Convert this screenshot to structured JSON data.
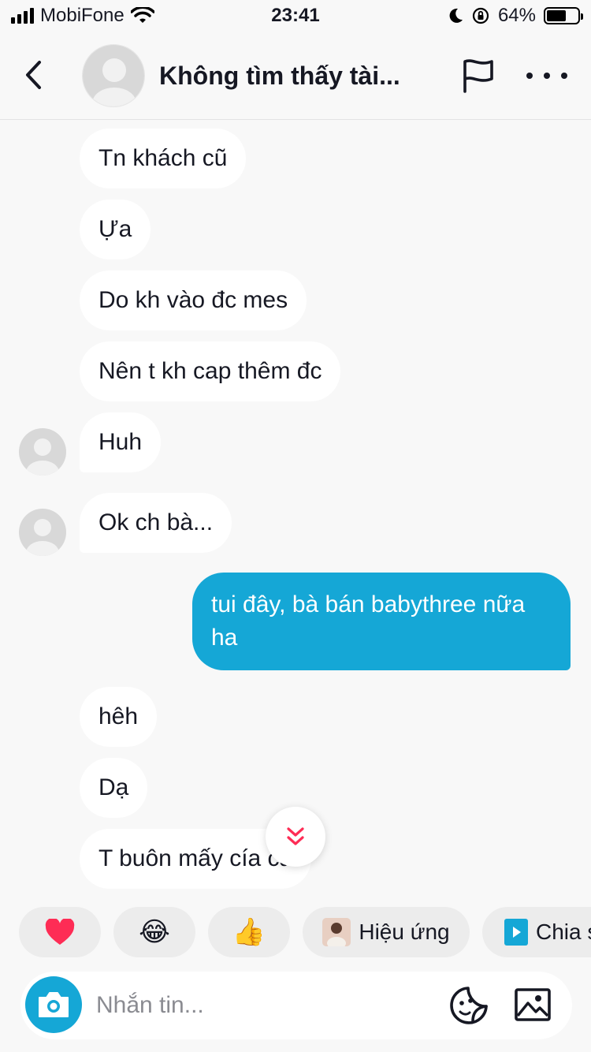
{
  "status_bar": {
    "carrier": "MobiFone",
    "time": "23:41",
    "battery": "64%",
    "battery_level": 0.64
  },
  "header": {
    "title": "Không tìm thấy tài..."
  },
  "messages": [
    {
      "text": "Tn khách cũ",
      "sender": "other"
    },
    {
      "text": "Ựa",
      "sender": "other"
    },
    {
      "text": "Do kh vào đc mes",
      "sender": "other"
    },
    {
      "text": "Nên t kh cap thêm đc",
      "sender": "other"
    },
    {
      "text": "Huh",
      "sender": "other"
    },
    {
      "text": "Ok ch bà...",
      "sender": "other"
    },
    {
      "text": "tui đây, bà bán babythree nữa ha",
      "sender": "me"
    },
    {
      "text": "hêh",
      "sender": "other"
    },
    {
      "text": "Dạ",
      "sender": "other"
    },
    {
      "text": "T buôn mấy cía ca",
      "sender": "other"
    }
  ],
  "quick_replies": [
    {
      "icon": "heart-icon",
      "glyph": "❤️"
    },
    {
      "icon": "laughing-emoji-icon",
      "glyph": "😂"
    },
    {
      "icon": "thumbs-up-icon",
      "glyph": "👍"
    },
    {
      "icon": "effect-thumbnail",
      "label": "Hiệu ứng"
    },
    {
      "icon": "share-icon",
      "label": "Chia s"
    }
  ],
  "input": {
    "placeholder": "Nhắn tin...",
    "value": ""
  },
  "colors": {
    "accent": "#15a7d6",
    "heart": "#fe2c55",
    "scroll_chevron": "#fe2c55",
    "background": "#f8f8f8"
  }
}
